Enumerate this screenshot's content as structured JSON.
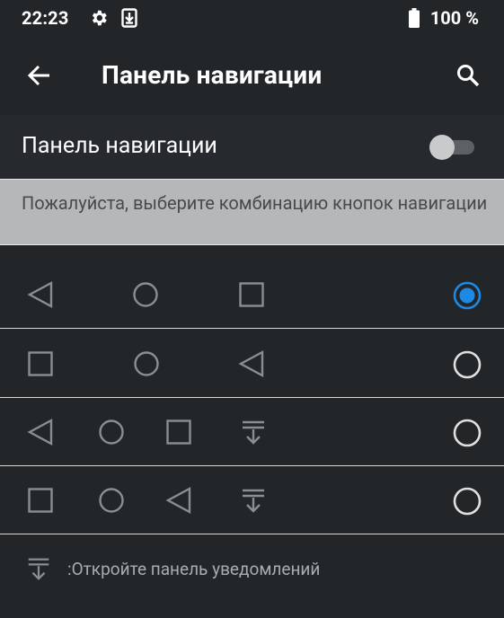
{
  "status_bar": {
    "time": "22:23",
    "battery_text": "100 %"
  },
  "app_bar": {
    "title": "Панель навигации"
  },
  "toggle": {
    "label": "Панель навигации",
    "checked": false
  },
  "hint": "Пожалуйста, выберите комбинацию кнопок навигации",
  "options": [
    {
      "icons": [
        "back-triangle",
        "home-circle",
        "recents-square"
      ],
      "selected": true
    },
    {
      "icons": [
        "recents-square",
        "home-circle",
        "back-triangle"
      ],
      "selected": false
    },
    {
      "icons": [
        "back-triangle",
        "home-circle",
        "recents-square",
        "notification-pull"
      ],
      "selected": false
    },
    {
      "icons": [
        "recents-square",
        "home-circle",
        "back-triangle",
        "notification-pull"
      ],
      "selected": false
    }
  ],
  "footer": {
    "text": ":Откройте панель уведомлений"
  },
  "colors": {
    "background": "#222629",
    "accent": "#1e88e5",
    "icon_gray": "#8b8e91",
    "hint_bg": "#b6b7b8"
  }
}
